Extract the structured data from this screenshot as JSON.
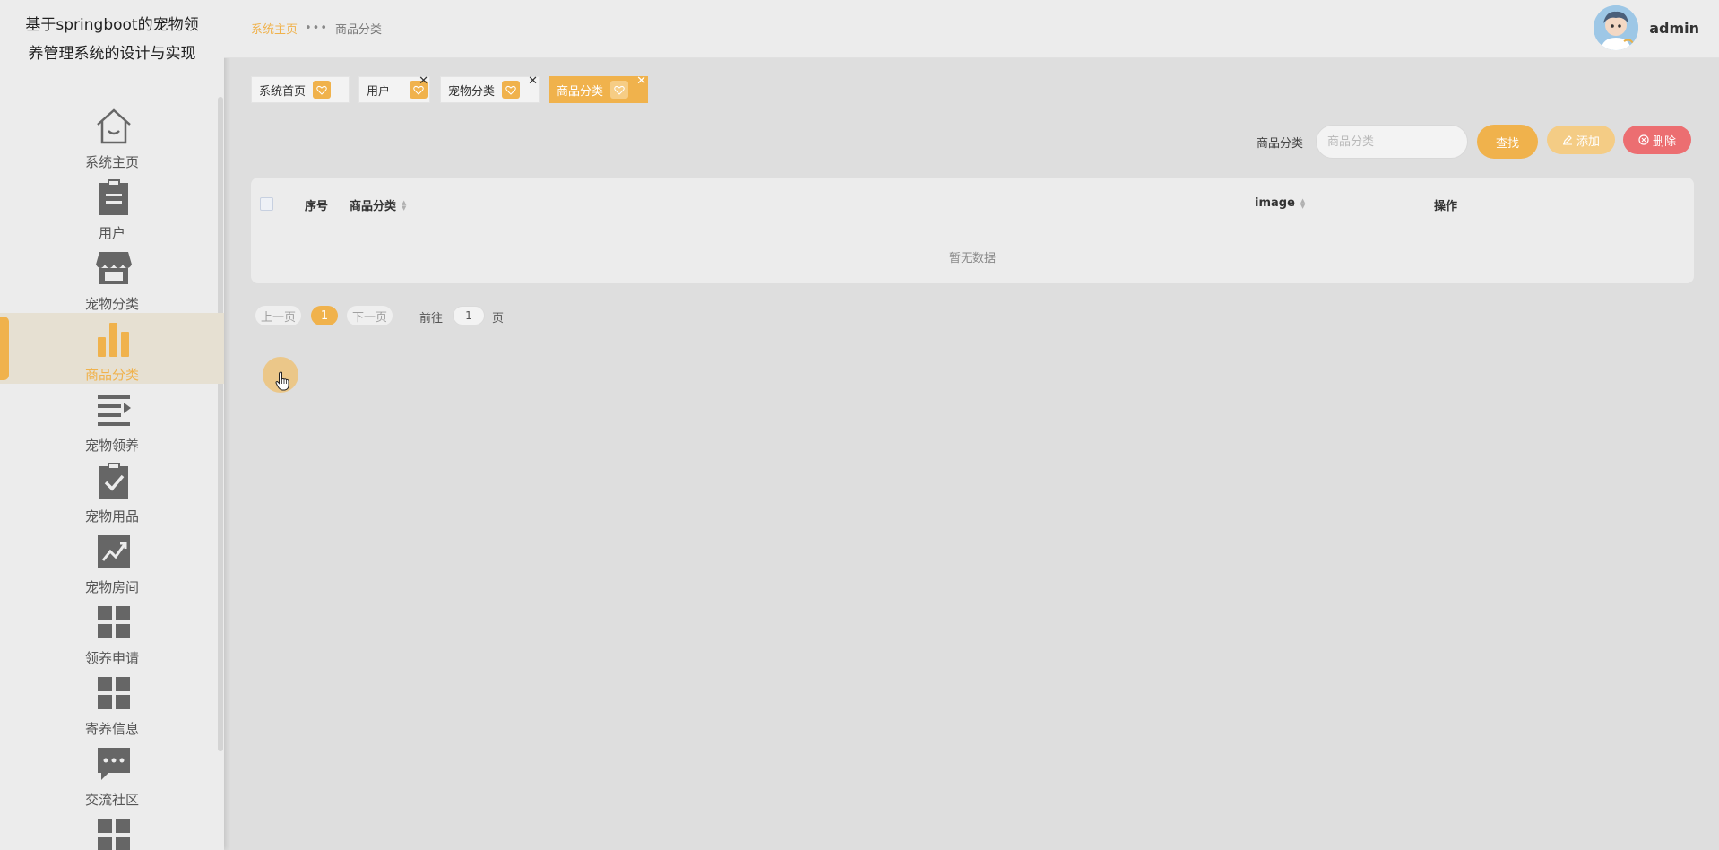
{
  "app": {
    "title": "基于springboot的宠物领养管理系统的设计与实现",
    "title_line1": "基于springboot的宠物领",
    "title_line2": "养管理系统的设计与实现"
  },
  "colors": {
    "accent": "#f0b24c",
    "danger": "#ec6e71",
    "sidebar_bg": "#ececec",
    "page_bg": "#dedede"
  },
  "sidebar": {
    "items": [
      {
        "label": "系统主页",
        "icon": "home-icon"
      },
      {
        "label": "用户",
        "icon": "clipboard-icon"
      },
      {
        "label": "宠物分类",
        "icon": "shop-icon"
      },
      {
        "label": "商品分类",
        "icon": "bar-chart-icon",
        "active": true
      },
      {
        "label": "宠物领养",
        "icon": "list-icon"
      },
      {
        "label": "宠物用品",
        "icon": "clipboard-check-icon"
      },
      {
        "label": "宠物房间",
        "icon": "trend-chart-icon"
      },
      {
        "label": "领养申请",
        "icon": "grid-icon"
      },
      {
        "label": "寄养信息",
        "icon": "grid-icon"
      },
      {
        "label": "交流社区",
        "icon": "chat-icon"
      },
      {
        "label": "",
        "icon": "grid-icon"
      }
    ]
  },
  "header": {
    "breadcrumb": {
      "home": "系统主页",
      "current": "商品分类"
    },
    "user": {
      "name": "admin"
    }
  },
  "tabs": [
    {
      "label": "系统首页",
      "closable": false
    },
    {
      "label": "用户",
      "closable": true
    },
    {
      "label": "宠物分类",
      "closable": true
    },
    {
      "label": "商品分类",
      "closable": true,
      "active": true
    }
  ],
  "search": {
    "label": "商品分类",
    "placeholder": "商品分类",
    "value": "",
    "search_button": "查找",
    "add_button": "添加",
    "delete_button": "删除"
  },
  "table": {
    "columns": [
      "序号",
      "商品分类",
      "image",
      "操作"
    ],
    "empty_text": "暂无数据",
    "rows": []
  },
  "pagination": {
    "prev": "上一页",
    "current_page": "1",
    "next": "下一页",
    "goto_label": "前往",
    "goto_value": "1",
    "page_unit": "页"
  }
}
